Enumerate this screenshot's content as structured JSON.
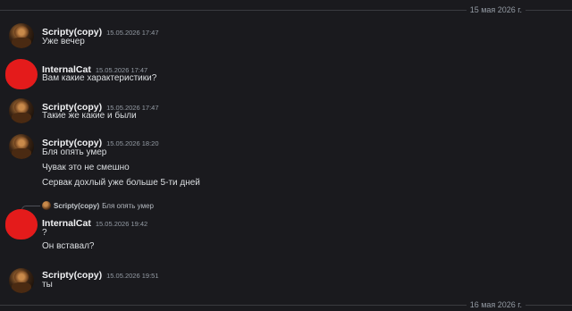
{
  "date_separators": [
    "15 мая 2026 г.",
    "16 мая 2026 г."
  ],
  "messages": [
    {
      "author": "Scripty(copy)",
      "time": "15.05.2026 17:47",
      "lines": [
        "Уже вечер"
      ]
    },
    {
      "author": "InternalCat",
      "time": "15.05.2026 17:47",
      "lines": [
        "Вам какие характеристики?"
      ]
    },
    {
      "author": "Scripty(copy)",
      "time": "15.05.2026 17:47",
      "lines": [
        "Такие же какие и были"
      ]
    },
    {
      "author": "Scripty(copy)",
      "time": "15.05.2026 18:20",
      "lines": [
        "Бля опять умер",
        "Чувак это не смешно",
        "Сервак дохлый уже больше 5-ти дней"
      ]
    },
    {
      "author": "InternalCat",
      "time": "15.05.2026 19:42",
      "reply": {
        "author": "Scripty(copy)",
        "text": "Бля опять умер"
      },
      "lines": [
        "?",
        "Он вставал?"
      ]
    },
    {
      "author": "Scripty(copy)",
      "time": "15.05.2026 19:51",
      "lines": [
        "ты"
      ]
    }
  ]
}
